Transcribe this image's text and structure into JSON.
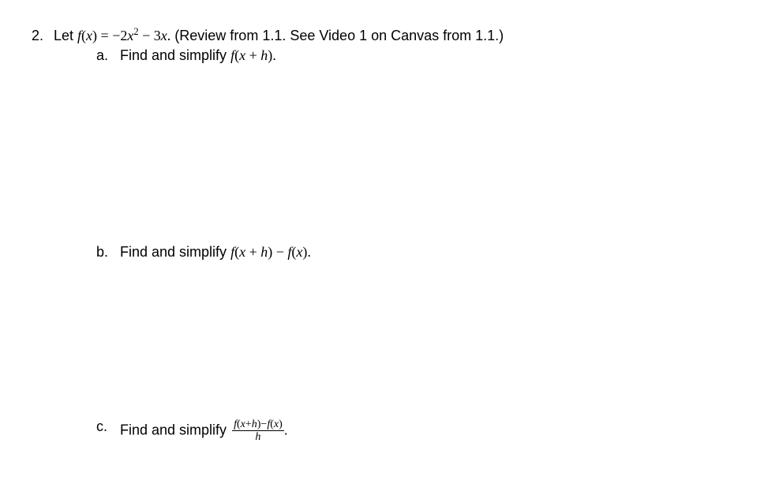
{
  "problem": {
    "number": "2.",
    "intro_prefix": "Let ",
    "intro_math_func": "f",
    "intro_math_open": "(",
    "intro_math_var": "x",
    "intro_math_close": ") = −2",
    "intro_math_var2": "x",
    "intro_math_exp": "2",
    "intro_math_mid": " − 3",
    "intro_math_var3": "x",
    "intro_math_end": ".",
    "intro_suffix": "  (Review from 1.1.  See Video 1 on Canvas from 1.1.)",
    "subs": {
      "a": {
        "letter": "a.",
        "text_prefix": "Find and simplify  ",
        "math_f": "f",
        "math_open": "(",
        "math_x": "x",
        "math_plus": " + ",
        "math_h": "h",
        "math_close": ").",
        "text_suffix": ""
      },
      "b": {
        "letter": "b.",
        "text_prefix": "Find and simplify  ",
        "math_f1": "f",
        "math_open1": "(",
        "math_x1": "x",
        "math_plus": " + ",
        "math_h1": "h",
        "math_close1": ") − ",
        "math_f2": "f",
        "math_open2": "(",
        "math_x2": "x",
        "math_close2": ").",
        "text_suffix": ""
      },
      "c": {
        "letter": "c.",
        "text_prefix": "Find and simplify ",
        "frac_num_f1": "f",
        "frac_num_open1": "(",
        "frac_num_x": "x",
        "frac_num_plus": "+",
        "frac_num_h1": "h",
        "frac_num_close1": ")−",
        "frac_num_f2": "f",
        "frac_num_open2": "(",
        "frac_num_x2": "x",
        "frac_num_close2": ")",
        "frac_den": "h",
        "text_suffix": "."
      }
    }
  }
}
